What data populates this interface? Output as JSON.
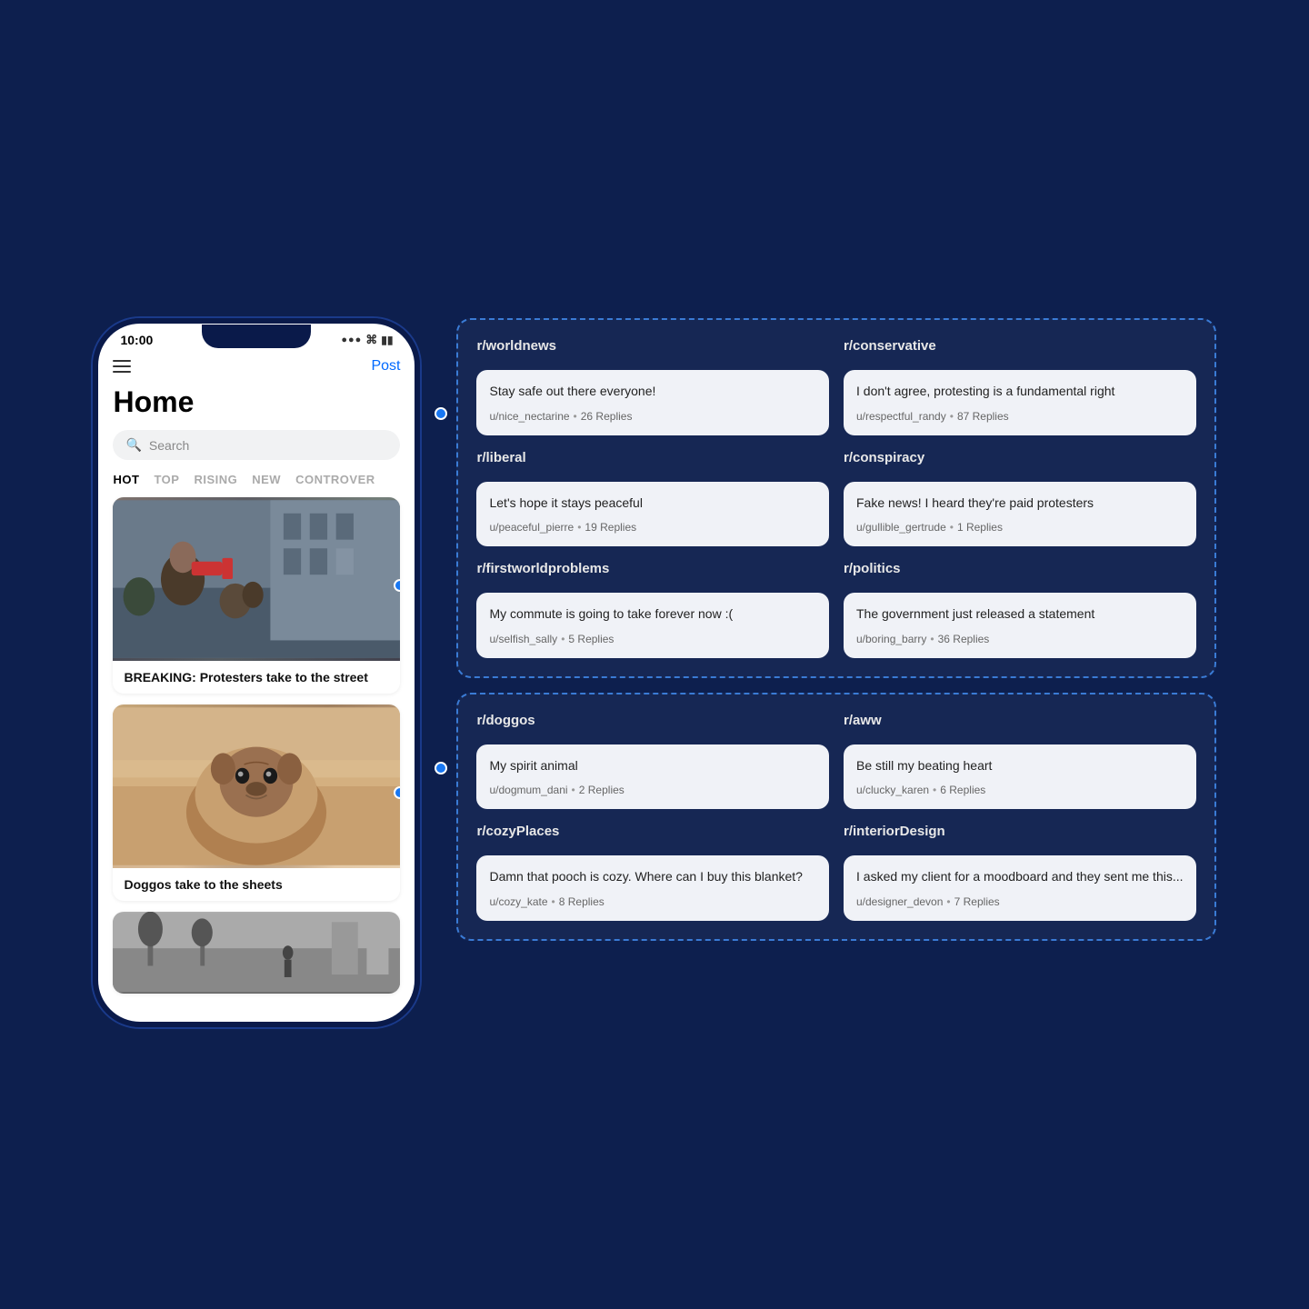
{
  "app": {
    "background_color": "#0d1f4e"
  },
  "phone": {
    "status_time": "10:00",
    "nav_post": "Post",
    "home_title": "Home",
    "search_placeholder": "Search",
    "filter_tabs": [
      "HOT",
      "TOP",
      "RISING",
      "NEW",
      "CONTROVER"
    ],
    "active_tab": "HOT",
    "posts": [
      {
        "title": "BREAKING: Protesters take to the street",
        "image_type": "protesters"
      },
      {
        "title": "Doggos take to the sheets",
        "image_type": "pug"
      },
      {
        "title": "",
        "image_type": "city"
      }
    ]
  },
  "panels": [
    {
      "id": "panel1",
      "columns": [
        {
          "subreddit": "r/worldnews",
          "comment": "Stay safe out there everyone!",
          "user": "u/nice_nectarine",
          "replies": "26 Replies"
        },
        {
          "subreddit": "r/conservative",
          "comment": "I don't agree, protesting is a fundamental right",
          "user": "u/respectful_randy",
          "replies": "87 Replies"
        }
      ]
    },
    {
      "id": "panel1b",
      "columns": [
        {
          "subreddit": "r/liberal",
          "comment": "Let's hope it stays peaceful",
          "user": "u/peaceful_pierre",
          "replies": "19 Replies"
        },
        {
          "subreddit": "r/conspiracy",
          "comment": "Fake news! I heard they're paid protesters",
          "user": "u/gullible_gertrude",
          "replies": "1 Replies"
        }
      ]
    },
    {
      "id": "panel1c",
      "columns": [
        {
          "subreddit": "r/firstworldproblems",
          "comment": "My commute is going to take forever now :(",
          "user": "u/selfish_sally",
          "replies": "5 Replies"
        },
        {
          "subreddit": "r/politics",
          "comment": "The government just released a statement",
          "user": "u/boring_barry",
          "replies": "36 Replies"
        }
      ]
    }
  ],
  "panels2": [
    {
      "id": "panel2a",
      "columns": [
        {
          "subreddit": "r/doggos",
          "comment": "My spirit animal",
          "user": "u/dogmum_dani",
          "replies": "2 Replies"
        },
        {
          "subreddit": "r/aww",
          "comment": "Be still my beating heart",
          "user": "u/clucky_karen",
          "replies": "6 Replies"
        }
      ]
    },
    {
      "id": "panel2b",
      "columns": [
        {
          "subreddit": "r/cozyPlaces",
          "comment": "Damn that pooch is cozy. Where can I buy this blanket?",
          "user": "u/cozy_kate",
          "replies": "8 Replies"
        },
        {
          "subreddit": "r/interiorDesign",
          "comment": "I asked my client for a moodboard and they sent me this...",
          "user": "u/designer_devon",
          "replies": "7 Replies"
        }
      ]
    }
  ]
}
